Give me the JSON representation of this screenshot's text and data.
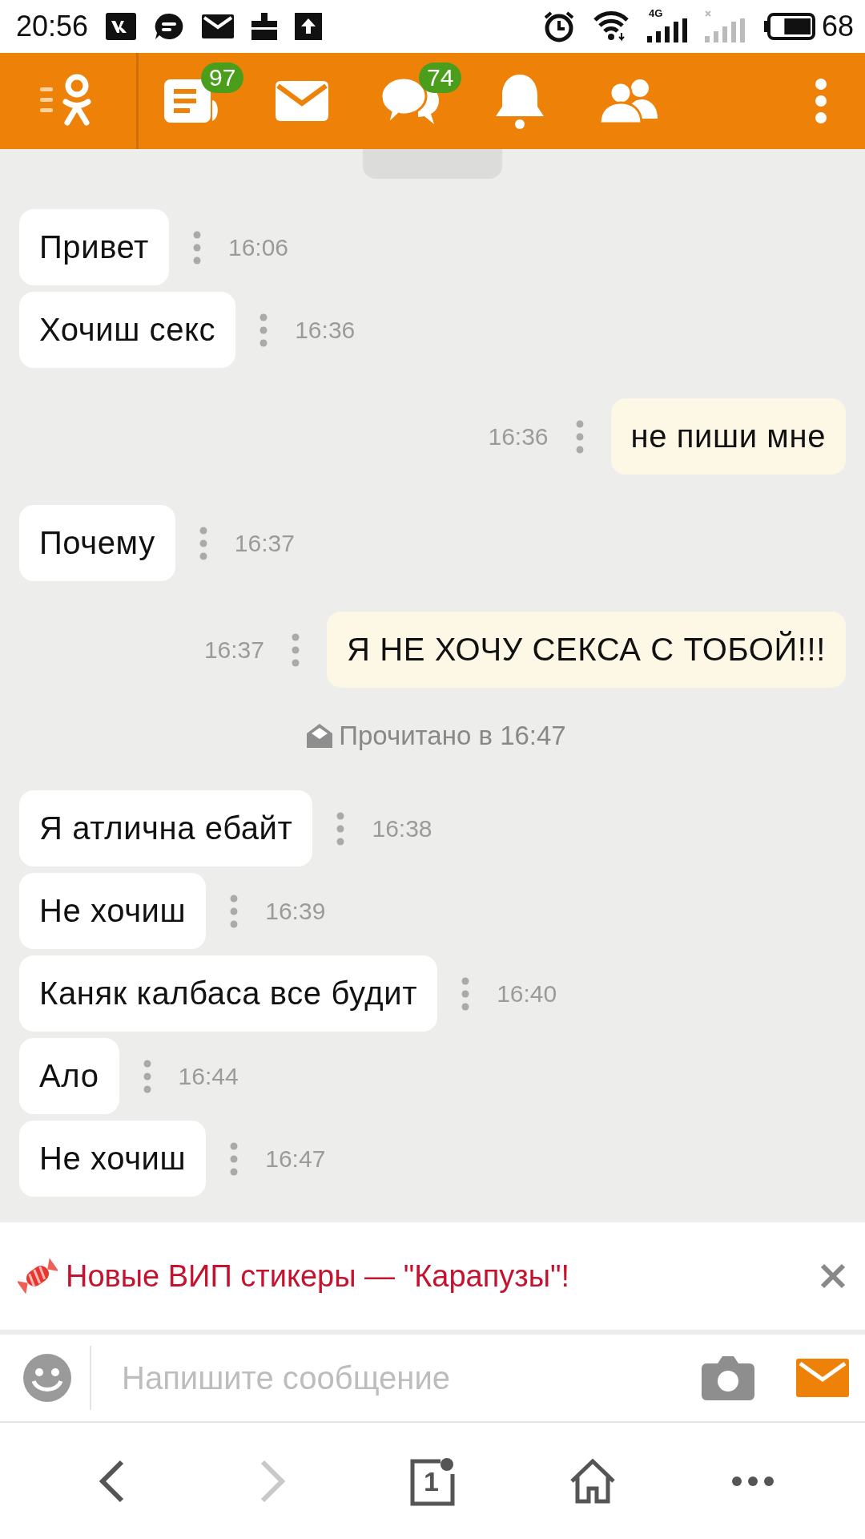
{
  "status_bar": {
    "time": "20:56",
    "network": "4G",
    "battery": "68"
  },
  "toolbar": {
    "items": [
      {
        "kind": "feed",
        "badge": "97"
      },
      {
        "kind": "mail"
      },
      {
        "kind": "chats",
        "badge": "74"
      },
      {
        "kind": "notifications"
      },
      {
        "kind": "friends"
      }
    ]
  },
  "messages": [
    {
      "kind": "incoming",
      "text": "Привет",
      "time": "16:06"
    },
    {
      "kind": "incoming",
      "text": "Хочиш секс",
      "time": "16:36"
    },
    {
      "kind": "outgoing",
      "text": "не пиши мне",
      "time": "16:36"
    },
    {
      "kind": "incoming",
      "text": "Почему",
      "time": "16:37"
    },
    {
      "kind": "outgoing",
      "text": "Я НЕ ХОЧУ СЕКСА  С ТОБОЙ!!!",
      "time": "16:37"
    },
    {
      "kind": "receipt",
      "text": "Прочитано в 16:47"
    },
    {
      "kind": "incoming",
      "text": "Я атлична ебайт",
      "time": "16:38"
    },
    {
      "kind": "incoming",
      "text": "Не хочиш",
      "time": "16:39"
    },
    {
      "kind": "incoming",
      "text": "Каняк калбаса все будит",
      "time": "16:40"
    },
    {
      "kind": "incoming",
      "text": "Ало",
      "time": "16:44"
    },
    {
      "kind": "incoming",
      "text": "Не хочиш",
      "time": "16:47"
    }
  ],
  "banner": {
    "text": "Новые ВИП стикеры — \"Карапузы\"!"
  },
  "composer": {
    "placeholder": "Напишите сообщение"
  },
  "browser_nav": {
    "tabs_count": "1",
    "forward_disabled": true
  }
}
